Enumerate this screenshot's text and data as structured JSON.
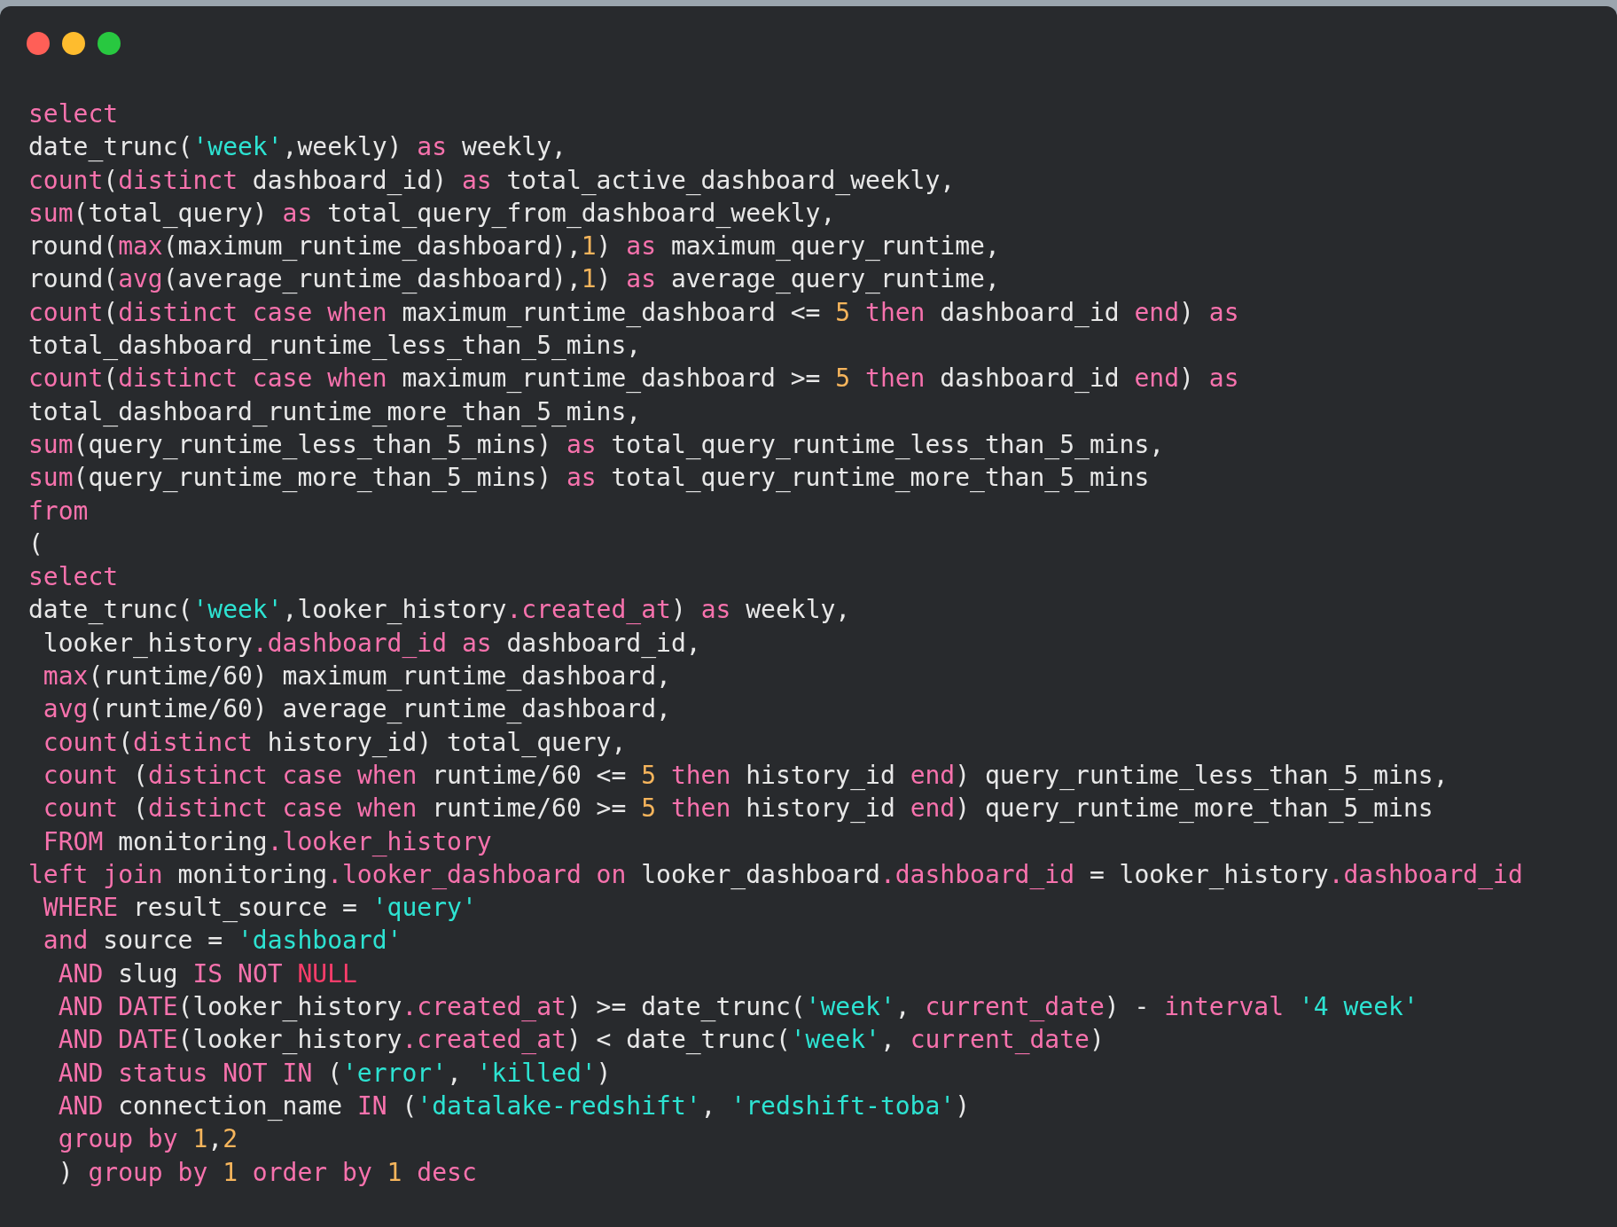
{
  "code_lines": [
    [
      {
        "kind": "keyword",
        "text": "select"
      }
    ],
    [
      {
        "kind": "plain",
        "text": "date_trunc("
      },
      {
        "kind": "string",
        "text": "'week'"
      },
      {
        "kind": "plain",
        "text": ",weekly) "
      },
      {
        "kind": "keyword",
        "text": "as"
      },
      {
        "kind": "plain",
        "text": " weekly,"
      }
    ],
    [
      {
        "kind": "keyword",
        "text": "count"
      },
      {
        "kind": "plain",
        "text": "("
      },
      {
        "kind": "keyword",
        "text": "distinct"
      },
      {
        "kind": "plain",
        "text": " dashboard_id) "
      },
      {
        "kind": "keyword",
        "text": "as"
      },
      {
        "kind": "plain",
        "text": " total_active_dashboard_weekly,"
      }
    ],
    [
      {
        "kind": "keyword",
        "text": "sum"
      },
      {
        "kind": "plain",
        "text": "(total_query) "
      },
      {
        "kind": "keyword",
        "text": "as"
      },
      {
        "kind": "plain",
        "text": " total_query_from_dashboard_weekly,"
      }
    ],
    [
      {
        "kind": "plain",
        "text": "round("
      },
      {
        "kind": "keyword",
        "text": "max"
      },
      {
        "kind": "plain",
        "text": "(maximum_runtime_dashboard),"
      },
      {
        "kind": "number",
        "text": "1"
      },
      {
        "kind": "plain",
        "text": ") "
      },
      {
        "kind": "keyword",
        "text": "as"
      },
      {
        "kind": "plain",
        "text": " maximum_query_runtime,"
      }
    ],
    [
      {
        "kind": "plain",
        "text": "round("
      },
      {
        "kind": "keyword",
        "text": "avg"
      },
      {
        "kind": "plain",
        "text": "(average_runtime_dashboard),"
      },
      {
        "kind": "number",
        "text": "1"
      },
      {
        "kind": "plain",
        "text": ") "
      },
      {
        "kind": "keyword",
        "text": "as"
      },
      {
        "kind": "plain",
        "text": " average_query_runtime,"
      }
    ],
    [
      {
        "kind": "keyword",
        "text": "count"
      },
      {
        "kind": "plain",
        "text": "("
      },
      {
        "kind": "keyword",
        "text": "distinct case when"
      },
      {
        "kind": "plain",
        "text": " maximum_runtime_dashboard <= "
      },
      {
        "kind": "number",
        "text": "5"
      },
      {
        "kind": "keyword",
        "text": " then"
      },
      {
        "kind": "plain",
        "text": " dashboard_id "
      },
      {
        "kind": "keyword",
        "text": "end"
      },
      {
        "kind": "plain",
        "text": ") "
      },
      {
        "kind": "keyword",
        "text": "as"
      }
    ],
    [
      {
        "kind": "plain",
        "text": "total_dashboard_runtime_less_than_5_mins,"
      }
    ],
    [
      {
        "kind": "keyword",
        "text": "count"
      },
      {
        "kind": "plain",
        "text": "("
      },
      {
        "kind": "keyword",
        "text": "distinct case when"
      },
      {
        "kind": "plain",
        "text": " maximum_runtime_dashboard >= "
      },
      {
        "kind": "number",
        "text": "5"
      },
      {
        "kind": "keyword",
        "text": " then"
      },
      {
        "kind": "plain",
        "text": " dashboard_id "
      },
      {
        "kind": "keyword",
        "text": "end"
      },
      {
        "kind": "plain",
        "text": ") "
      },
      {
        "kind": "keyword",
        "text": "as"
      }
    ],
    [
      {
        "kind": "plain",
        "text": "total_dashboard_runtime_more_than_5_mins,"
      }
    ],
    [
      {
        "kind": "keyword",
        "text": "sum"
      },
      {
        "kind": "plain",
        "text": "(query_runtime_less_than_5_mins) "
      },
      {
        "kind": "keyword",
        "text": "as"
      },
      {
        "kind": "plain",
        "text": " total_query_runtime_less_than_5_mins,"
      }
    ],
    [
      {
        "kind": "keyword",
        "text": "sum"
      },
      {
        "kind": "plain",
        "text": "(query_runtime_more_than_5_mins) "
      },
      {
        "kind": "keyword",
        "text": "as"
      },
      {
        "kind": "plain",
        "text": " total_query_runtime_more_than_5_mins"
      }
    ],
    [
      {
        "kind": "keyword",
        "text": "from"
      }
    ],
    [
      {
        "kind": "plain",
        "text": "("
      }
    ],
    [
      {
        "kind": "keyword",
        "text": "select"
      }
    ],
    [
      {
        "kind": "plain",
        "text": "date_trunc("
      },
      {
        "kind": "string",
        "text": "'week'"
      },
      {
        "kind": "plain",
        "text": ",looker_history"
      },
      {
        "kind": "member",
        "text": ".created_at"
      },
      {
        "kind": "plain",
        "text": ") "
      },
      {
        "kind": "keyword",
        "text": "as"
      },
      {
        "kind": "plain",
        "text": " weekly,"
      }
    ],
    [
      {
        "kind": "plain",
        "text": " looker_history"
      },
      {
        "kind": "member",
        "text": ".dashboard_id"
      },
      {
        "kind": "keyword",
        "text": " as"
      },
      {
        "kind": "plain",
        "text": " dashboard_id,"
      }
    ],
    [
      {
        "kind": "keyword",
        "text": " max"
      },
      {
        "kind": "plain",
        "text": "(runtime/60) maximum_runtime_dashboard,"
      }
    ],
    [
      {
        "kind": "keyword",
        "text": " avg"
      },
      {
        "kind": "plain",
        "text": "(runtime/60) average_runtime_dashboard,"
      }
    ],
    [
      {
        "kind": "keyword",
        "text": " count"
      },
      {
        "kind": "plain",
        "text": "("
      },
      {
        "kind": "keyword",
        "text": "distinct"
      },
      {
        "kind": "plain",
        "text": " history_id) total_query,"
      }
    ],
    [
      {
        "kind": "keyword",
        "text": " count"
      },
      {
        "kind": "plain",
        "text": " ("
      },
      {
        "kind": "keyword",
        "text": "distinct case when"
      },
      {
        "kind": "plain",
        "text": " runtime/60 <= "
      },
      {
        "kind": "number",
        "text": "5"
      },
      {
        "kind": "keyword",
        "text": " then"
      },
      {
        "kind": "plain",
        "text": " history_id "
      },
      {
        "kind": "keyword",
        "text": "end"
      },
      {
        "kind": "plain",
        "text": ") query_runtime_less_than_5_mins,"
      }
    ],
    [
      {
        "kind": "keyword",
        "text": " count"
      },
      {
        "kind": "plain",
        "text": " ("
      },
      {
        "kind": "keyword",
        "text": "distinct case when"
      },
      {
        "kind": "plain",
        "text": " runtime/60 >= "
      },
      {
        "kind": "number",
        "text": "5"
      },
      {
        "kind": "keyword",
        "text": " then"
      },
      {
        "kind": "plain",
        "text": " history_id "
      },
      {
        "kind": "keyword",
        "text": "end"
      },
      {
        "kind": "plain",
        "text": ") query_runtime_more_than_5_mins"
      }
    ],
    [
      {
        "kind": "keyword",
        "text": " FROM"
      },
      {
        "kind": "plain",
        "text": " monitoring"
      },
      {
        "kind": "member",
        "text": ".looker_history"
      }
    ],
    [
      {
        "kind": "keyword",
        "text": "left join"
      },
      {
        "kind": "plain",
        "text": " monitoring"
      },
      {
        "kind": "member",
        "text": ".looker_dashboard"
      },
      {
        "kind": "keyword",
        "text": " on"
      },
      {
        "kind": "plain",
        "text": " looker_dashboard"
      },
      {
        "kind": "member",
        "text": ".dashboard_id"
      },
      {
        "kind": "plain",
        "text": " = looker_history"
      },
      {
        "kind": "member",
        "text": ".dashboard_id"
      }
    ],
    [
      {
        "kind": "keyword",
        "text": " WHERE"
      },
      {
        "kind": "plain",
        "text": " result_source = "
      },
      {
        "kind": "string",
        "text": "'query'"
      }
    ],
    [
      {
        "kind": "keyword",
        "text": " and"
      },
      {
        "kind": "plain",
        "text": " source = "
      },
      {
        "kind": "string",
        "text": "'dashboard'"
      }
    ],
    [
      {
        "kind": "keyword",
        "text": "  AND"
      },
      {
        "kind": "plain",
        "text": " slug "
      },
      {
        "kind": "keyword",
        "text": "IS NOT"
      },
      {
        "kind": "null",
        "text": " NULL"
      }
    ],
    [
      {
        "kind": "keyword",
        "text": "  AND DATE"
      },
      {
        "kind": "plain",
        "text": "(looker_history"
      },
      {
        "kind": "member",
        "text": ".created_at"
      },
      {
        "kind": "plain",
        "text": ") >= date_trunc("
      },
      {
        "kind": "string",
        "text": "'week'"
      },
      {
        "kind": "plain",
        "text": ", "
      },
      {
        "kind": "keyword",
        "text": "current_date"
      },
      {
        "kind": "plain",
        "text": ") - "
      },
      {
        "kind": "keyword",
        "text": "interval"
      },
      {
        "kind": "string",
        "text": " '4 week'"
      }
    ],
    [
      {
        "kind": "keyword",
        "text": "  AND DATE"
      },
      {
        "kind": "plain",
        "text": "(looker_history"
      },
      {
        "kind": "member",
        "text": ".created_at"
      },
      {
        "kind": "plain",
        "text": ") < date_trunc("
      },
      {
        "kind": "string",
        "text": "'week'"
      },
      {
        "kind": "plain",
        "text": ", "
      },
      {
        "kind": "keyword",
        "text": "current_date"
      },
      {
        "kind": "plain",
        "text": ")"
      }
    ],
    [
      {
        "kind": "keyword",
        "text": "  AND status NOT IN"
      },
      {
        "kind": "plain",
        "text": " ("
      },
      {
        "kind": "string",
        "text": "'error'"
      },
      {
        "kind": "plain",
        "text": ", "
      },
      {
        "kind": "string",
        "text": "'killed'"
      },
      {
        "kind": "plain",
        "text": ")"
      }
    ],
    [
      {
        "kind": "keyword",
        "text": "  AND"
      },
      {
        "kind": "plain",
        "text": " connection_name "
      },
      {
        "kind": "keyword",
        "text": "IN"
      },
      {
        "kind": "plain",
        "text": " ("
      },
      {
        "kind": "string",
        "text": "'datalake-redshift'"
      },
      {
        "kind": "plain",
        "text": ", "
      },
      {
        "kind": "string",
        "text": "'redshift-toba'"
      },
      {
        "kind": "plain",
        "text": ")"
      }
    ],
    [
      {
        "kind": "keyword",
        "text": "  group by"
      },
      {
        "kind": "number",
        "text": " 1"
      },
      {
        "kind": "plain",
        "text": ","
      },
      {
        "kind": "number",
        "text": "2"
      }
    ],
    [
      {
        "kind": "plain",
        "text": "  ) "
      },
      {
        "kind": "keyword",
        "text": "group by"
      },
      {
        "kind": "number",
        "text": " 1"
      },
      {
        "kind": "keyword",
        "text": " order by"
      },
      {
        "kind": "number",
        "text": " 1"
      },
      {
        "kind": "keyword",
        "text": " desc"
      }
    ]
  ]
}
